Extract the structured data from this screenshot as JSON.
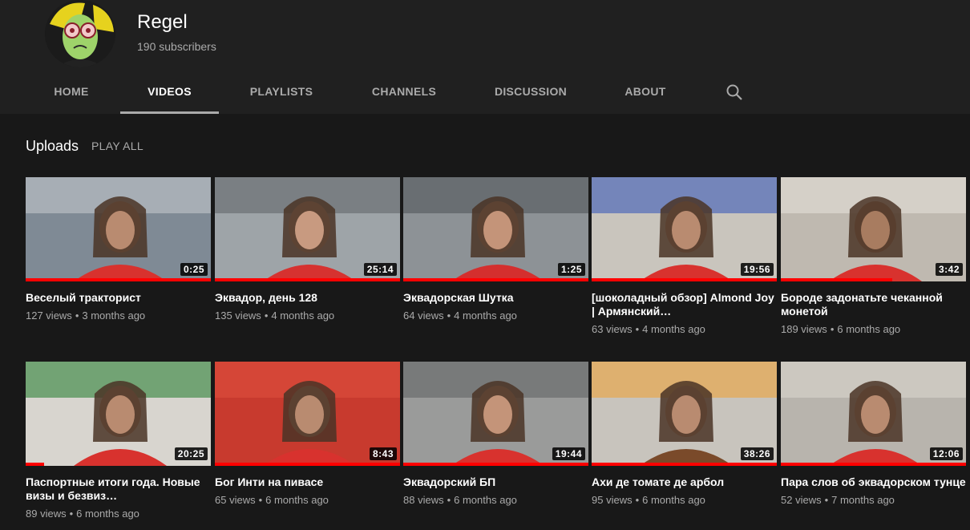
{
  "channel": {
    "name": "Regel",
    "subscribers": "190 subscribers"
  },
  "tabs": [
    {
      "label": "HOME",
      "active": false
    },
    {
      "label": "VIDEOS",
      "active": true
    },
    {
      "label": "PLAYLISTS",
      "active": false
    },
    {
      "label": "CHANNELS",
      "active": false
    },
    {
      "label": "DISCUSSION",
      "active": false
    },
    {
      "label": "ABOUT",
      "active": false
    }
  ],
  "section": {
    "title": "Uploads",
    "play_all": "PLAY ALL"
  },
  "colors": {
    "background": "#181818",
    "header": "#202020",
    "progress": "#ff0000",
    "secondary_text": "#aaaaaa"
  },
  "videos": [
    {
      "title": "Веселый тракторист",
      "views": "127 views",
      "age": "3 months ago",
      "duration": "0:25",
      "watched": 1.0
    },
    {
      "title": "Эквадор, день 128",
      "views": "135 views",
      "age": "4 months ago",
      "duration": "25:14",
      "watched": 1.0
    },
    {
      "title": "Эквадорская Шутка",
      "views": "64 views",
      "age": "4 months ago",
      "duration": "1:25",
      "watched": 1.0
    },
    {
      "title": "[шоколадный обзор] Almond Joy | Армянский…",
      "views": "63 views",
      "age": "4 months ago",
      "duration": "19:56",
      "watched": 1.0
    },
    {
      "title": "Бороде задонатьте чеканной монетой",
      "views": "189 views",
      "age": "6 months ago",
      "duration": "3:42",
      "watched": 0.6
    },
    {
      "title": "Паспортные итоги года. Новые визы и безвиз…",
      "views": "89 views",
      "age": "6 months ago",
      "duration": "20:25",
      "watched": 0.1
    },
    {
      "title": "Бог Инти на пивасе",
      "views": "65 views",
      "age": "6 months ago",
      "duration": "8:43",
      "watched": 1.0
    },
    {
      "title": "Эквадорский БП",
      "views": "88 views",
      "age": "6 months ago",
      "duration": "19:44",
      "watched": 1.0
    },
    {
      "title": "Ахи де томате де арбол",
      "views": "95 views",
      "age": "6 months ago",
      "duration": "38:26",
      "watched": 1.0
    },
    {
      "title": "Пара слов об эквадорском тунце",
      "views": "52 views",
      "age": "7 months ago",
      "duration": "12:06",
      "watched": 1.0
    }
  ]
}
